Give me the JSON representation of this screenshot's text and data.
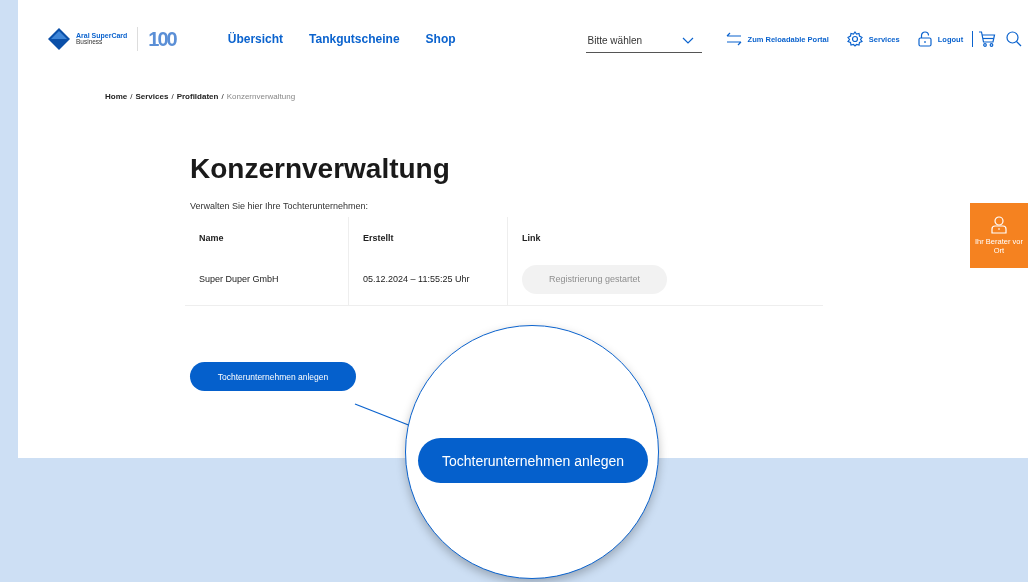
{
  "header": {
    "brand": "Aral SuperCard",
    "brand_sub": "Business",
    "logo_number": "100",
    "nav": [
      {
        "label": "Übersicht"
      },
      {
        "label": "Tankgutscheine"
      },
      {
        "label": "Shop"
      }
    ],
    "select": {
      "placeholder": "Bitte wählen"
    },
    "actions": [
      {
        "kind": "swap",
        "label": "Zum Reloadable Portal"
      },
      {
        "kind": "gear",
        "label": "Services"
      },
      {
        "kind": "lock",
        "label": "Logout"
      }
    ]
  },
  "breadcrumb": {
    "items": [
      "Home",
      "Services",
      "Profildaten"
    ],
    "separator": "/",
    "current": "Konzernverwaltung"
  },
  "page": {
    "title": "Konzernverwaltung",
    "intro": "Verwalten Sie hier Ihre Tochterunternehmen:"
  },
  "table": {
    "columns": [
      "Name",
      "Erstellt",
      "Link"
    ],
    "rows": [
      {
        "name": "Super Duper GmbH",
        "created": "05.12.2024 – 11:55:25 Uhr",
        "link": {
          "label": "Registrierung gestartet",
          "disabled": true
        }
      }
    ]
  },
  "add_button": "Tochterunternehmen anlegen",
  "advisor": {
    "label": "Ihr Berater vor Ort"
  },
  "magnifier": {
    "button": "Tochterunternehmen anlegen"
  }
}
